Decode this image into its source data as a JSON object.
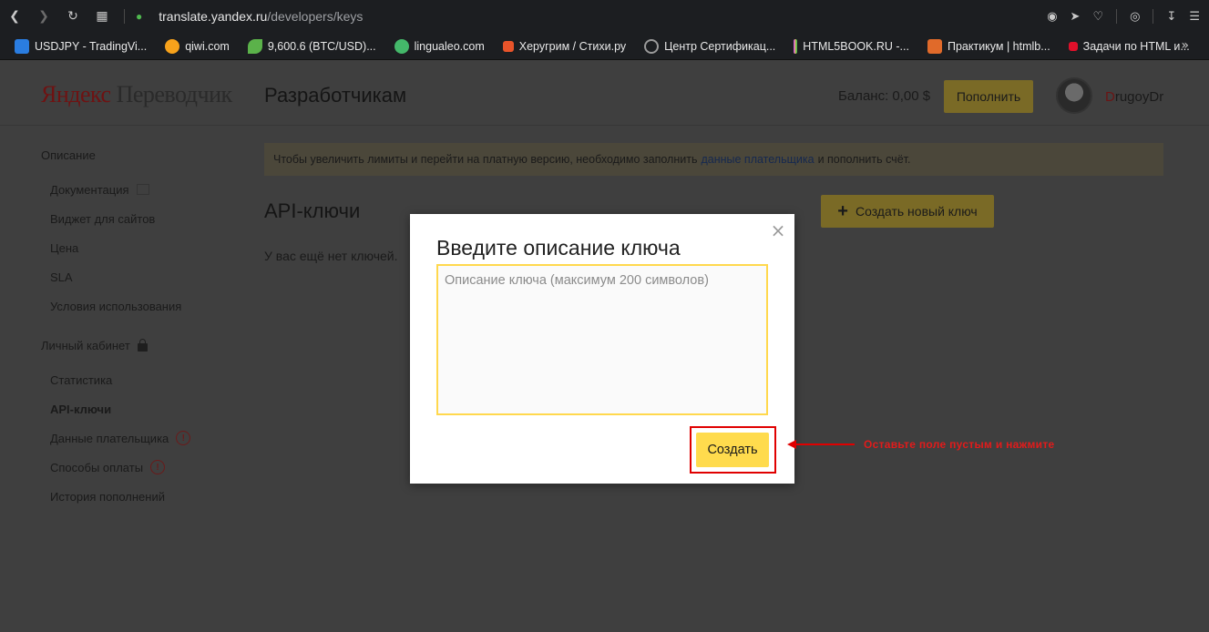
{
  "browser": {
    "url_host": "translate.yandex.ru",
    "url_path": "/developers/keys",
    "bookmarks": [
      {
        "label": "USDJPY - TradingVi...",
        "color": "#2a7de1"
      },
      {
        "label": "qiwi.com",
        "color": "#f7a21b"
      },
      {
        "label": "9,600.6 (BTC/USD)...",
        "color": "#5bb24a"
      },
      {
        "label": "lingualeo.com",
        "color": "#44b86a"
      },
      {
        "label": "Херугрим / Стихи.ру",
        "color": "#e8542a"
      },
      {
        "label": "Центр Сертификац...",
        "color": "#9a9a9a"
      },
      {
        "label": "HTML5BOOK.RU -...",
        "color": "#c95bd6"
      },
      {
        "label": "Практикум | htmlb...",
        "color": "#e06a2a"
      },
      {
        "label": "Задачи по HTML и...",
        "color": "#e0102a"
      }
    ],
    "more": "»"
  },
  "header": {
    "logo_first": "Яндекс",
    "logo_rest": " Переводчик",
    "section_title": "Разработчикам",
    "balance": "Баланс: 0,00 $",
    "topup_label": "Пополнить",
    "user_first": "D",
    "user_rest": "rugoyDr"
  },
  "sidebar": {
    "group1": "Описание",
    "items1": [
      "Документация",
      "Виджет для сайтов",
      "Цена",
      "SLA",
      "Условия использования"
    ],
    "group2": "Личный кабинет",
    "items2": [
      "Статистика",
      "API-ключи",
      "Данные плательщика",
      "Способы оплаты",
      "История пополнений"
    ]
  },
  "notice": {
    "before": "Чтобы увеличить лимиты и перейти на платную версию, необходимо заполнить",
    "link": "данные плательщика",
    "after": "и пополнить счёт."
  },
  "main": {
    "title": "API-ключи",
    "create_key_label": "Создать новый ключ",
    "empty_text": "У вас ещё нет ключей."
  },
  "modal": {
    "title": "Введите описание ключа",
    "placeholder": "Описание ключа (максимум 200 символов)",
    "create_label": "Создать",
    "close_symbol": "×"
  },
  "annotation": {
    "text": "Оставьте поле пустым и нажмите"
  },
  "colors": {
    "accent_yellow": "#ffdb4d",
    "annotation_red": "#e00000"
  }
}
